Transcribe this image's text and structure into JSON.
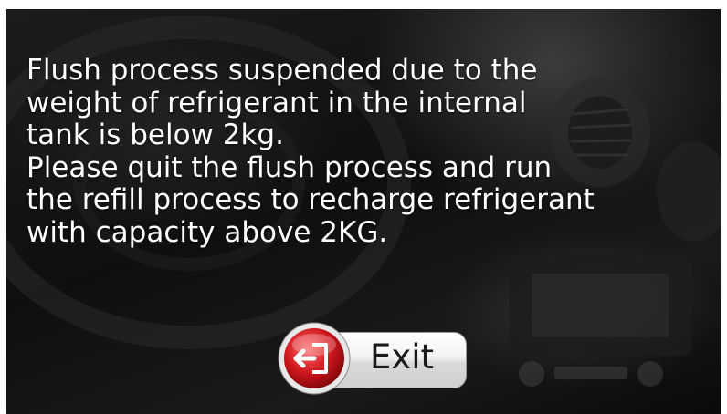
{
  "dialog": {
    "message_lines": [
      "Flush process suspended due to the",
      "weight of refrigerant in the internal",
      "tank is below 2kg.",
      "Please quit the flush process and run",
      "the refill process to recharge refrigerant",
      "with capacity above 2KG."
    ],
    "exit_label": "Exit",
    "exit_icon": "exit-door-arrow-icon"
  },
  "colors": {
    "background": "#121212",
    "text": "#ffffff",
    "exit_circle": "#c8141b",
    "exit_pill": "#eeeeee"
  }
}
